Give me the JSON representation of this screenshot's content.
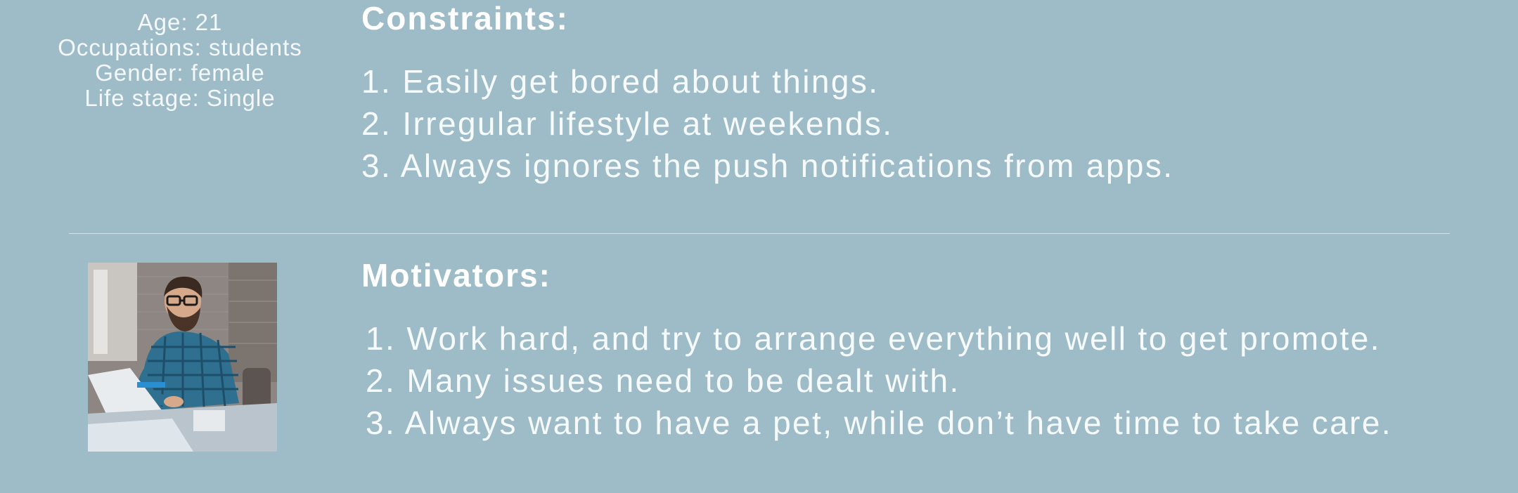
{
  "persona": {
    "age": "Age: 21",
    "occupation": "Occupations: students",
    "gender": "Gender: female",
    "life_stage": "Life stage: Single"
  },
  "constraints": {
    "title": "Constraints:",
    "items": [
      "1. Easily get bored about things.",
      "2. Irregular lifestyle at weekends.",
      "3. Always ignores the push notifications from apps."
    ]
  },
  "motivators": {
    "title": "Motivators:",
    "items": [
      "1. Work hard, and try to arrange everything well to get promote.",
      "2. Many issues need to be dealt with.",
      "3. Always want to have a pet, while don’t have time to take care."
    ]
  },
  "colors": {
    "background": "#9dbcc8",
    "text": "#ffffff"
  }
}
